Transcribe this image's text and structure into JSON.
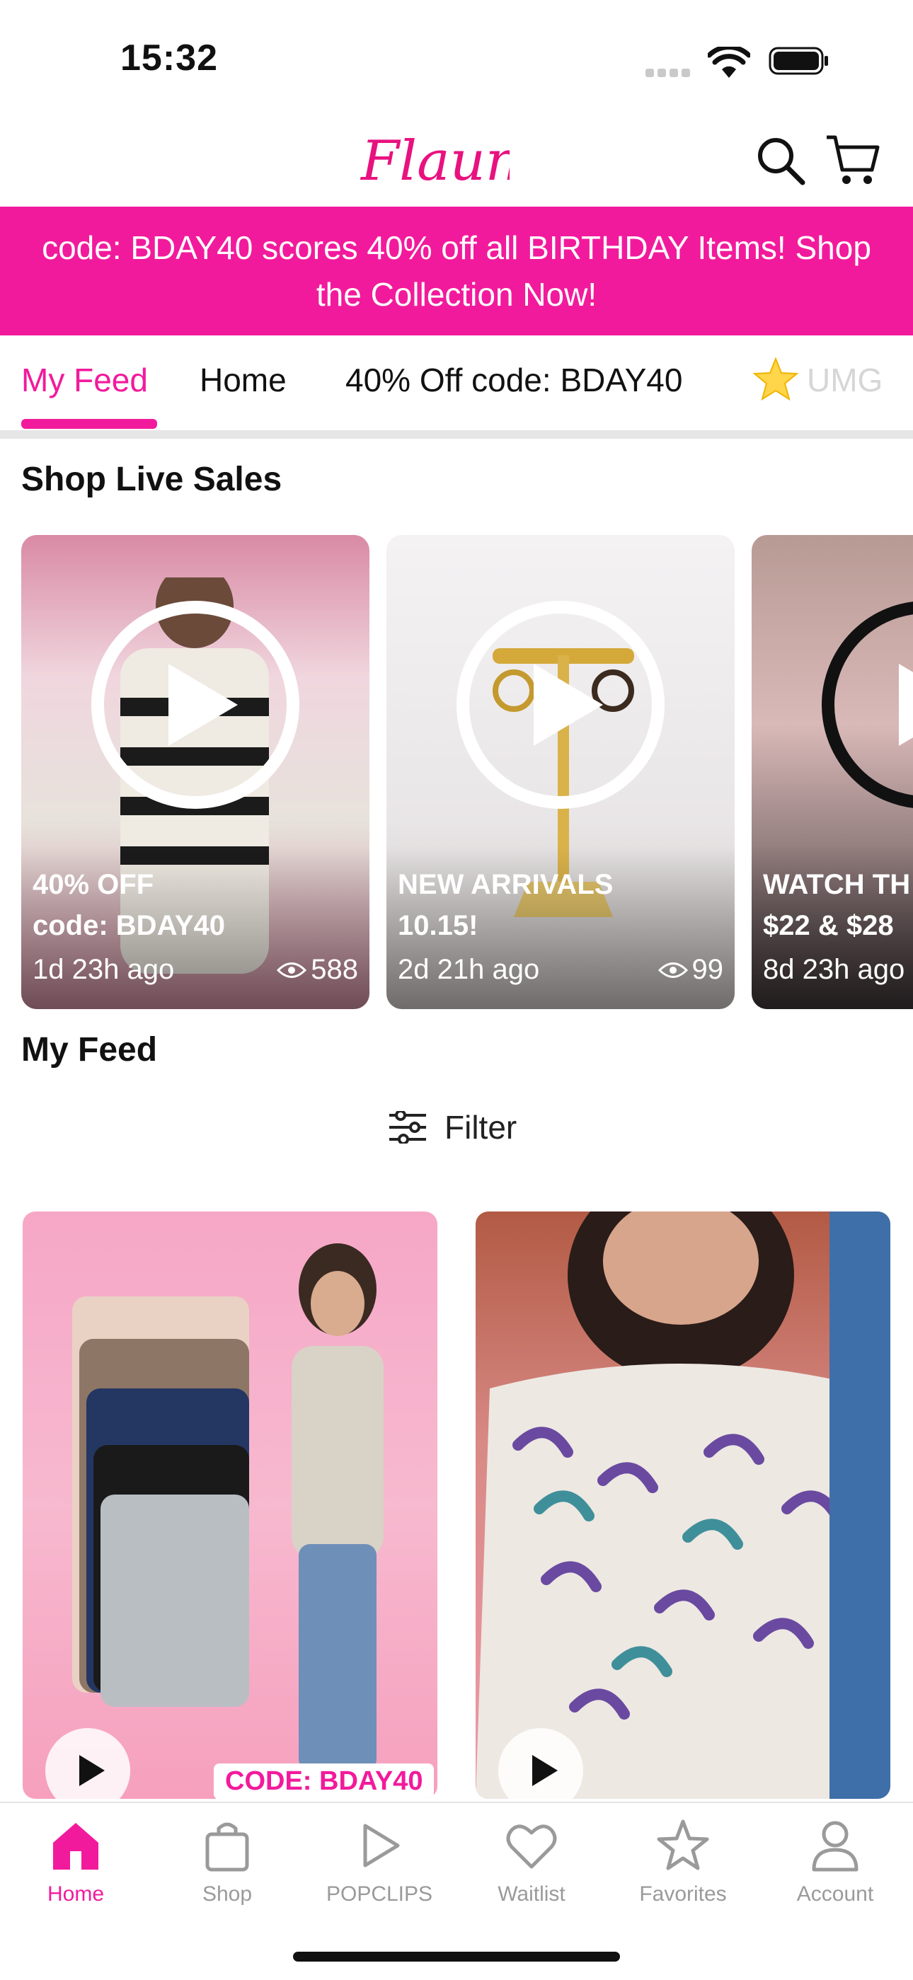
{
  "status_bar": {
    "time": "15:32"
  },
  "header": {
    "logo_text": "Flaunt",
    "search_icon": "search-icon",
    "cart_icon": "cart-icon"
  },
  "promo": {
    "text": "code: BDAY40 scores 40% off all BIRTHDAY Items! Shop the Collection Now!"
  },
  "tabs": [
    {
      "label": "My Feed",
      "active": true
    },
    {
      "label": "Home"
    },
    {
      "label": "40% Off code: BDAY40"
    },
    {
      "label": "UMG"
    }
  ],
  "live_section": {
    "title": "Shop Live Sales",
    "cards": [
      {
        "line1": "40% OFF",
        "line2": "code: BDAY40",
        "ago": "1d 23h ago",
        "views": "588"
      },
      {
        "line1": "NEW ARRIVALS",
        "line2": "10.15!",
        "ago": "2d 21h ago",
        "views": "99"
      },
      {
        "line1": "WATCH TH",
        "line2": "$22 & $28",
        "ago": "8d 23h ago"
      }
    ]
  },
  "feed_section": {
    "title": "My Feed",
    "filter_label": "Filter",
    "cards": [
      {
        "badge": "CODE: BDAY40"
      },
      {
        "badge": ""
      }
    ]
  },
  "bottom_nav": [
    {
      "label": "Home",
      "icon": "home-icon",
      "active": true
    },
    {
      "label": "Shop",
      "icon": "bag-icon"
    },
    {
      "label": "POPCLIPS",
      "icon": "play-icon"
    },
    {
      "label": "Waitlist",
      "icon": "heart-icon"
    },
    {
      "label": "Favorites",
      "icon": "star-icon"
    },
    {
      "label": "Account",
      "icon": "person-icon"
    }
  ],
  "colors": {
    "brand": "#f21a9c",
    "inactive": "#9a9a9a"
  }
}
